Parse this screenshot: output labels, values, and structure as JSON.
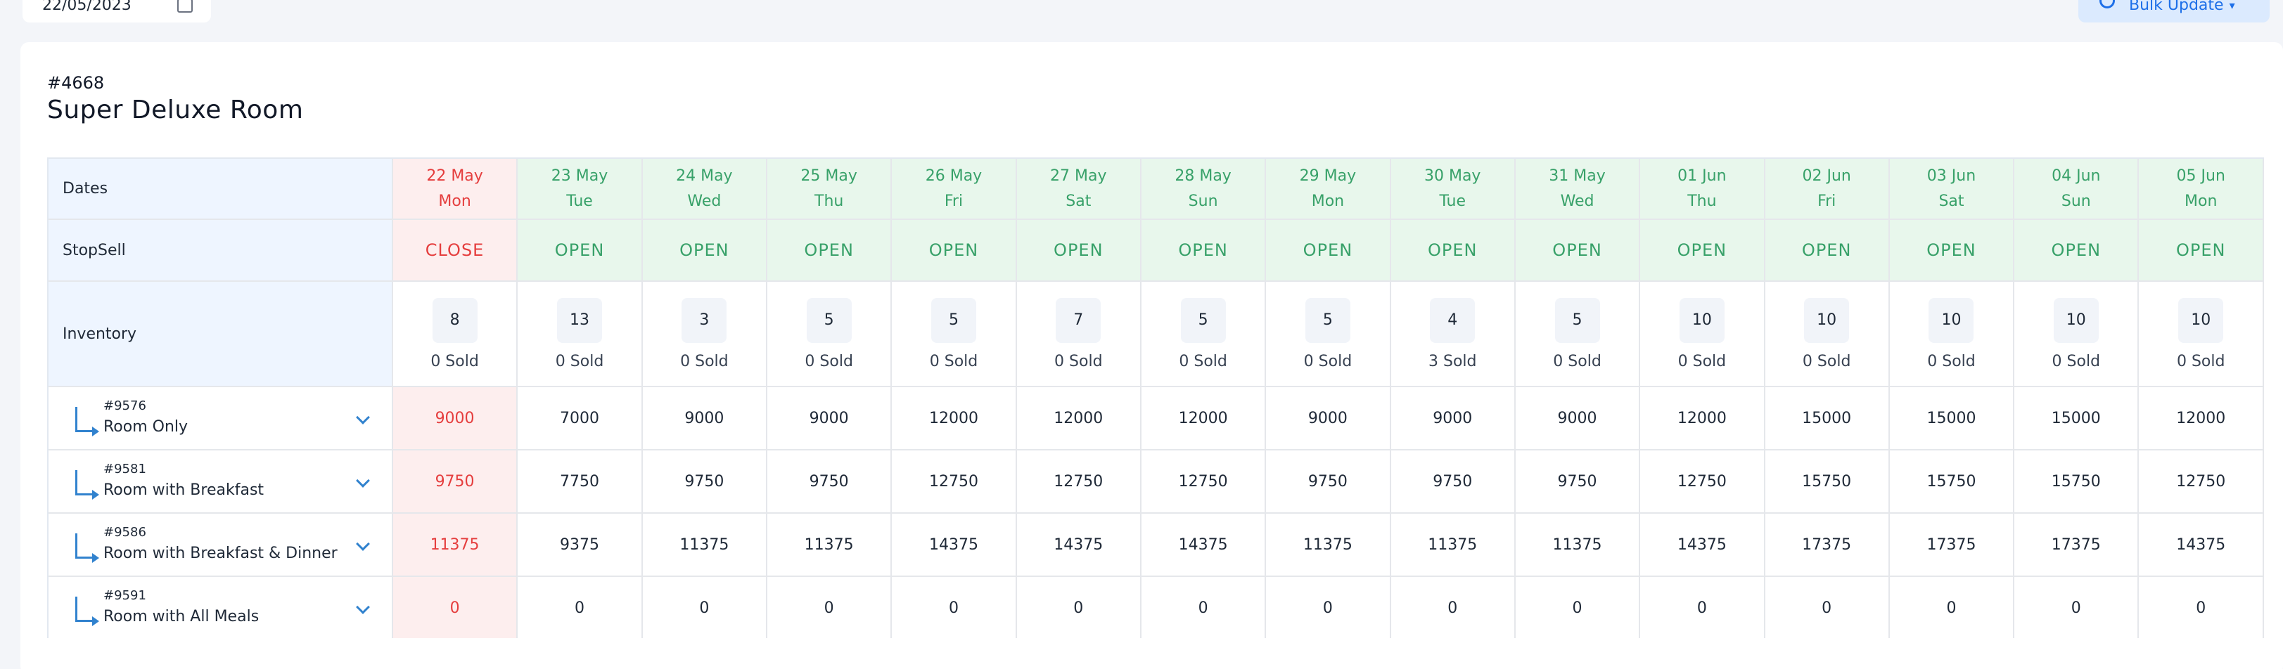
{
  "toolbar": {
    "date_value": "22/05/2023",
    "bulk_update_label": "Bulk Update"
  },
  "room": {
    "id": "#4668",
    "title": "Super Deluxe Room"
  },
  "row_labels": {
    "dates": "Dates",
    "stopsell": "StopSell",
    "inventory": "Inventory"
  },
  "days": [
    {
      "date": "22 May",
      "weekday": "Mon",
      "stopsell": "CLOSE",
      "inventory": "8",
      "sold": "0 Sold"
    },
    {
      "date": "23 May",
      "weekday": "Tue",
      "stopsell": "OPEN",
      "inventory": "13",
      "sold": "0 Sold"
    },
    {
      "date": "24 May",
      "weekday": "Wed",
      "stopsell": "OPEN",
      "inventory": "3",
      "sold": "0 Sold"
    },
    {
      "date": "25 May",
      "weekday": "Thu",
      "stopsell": "OPEN",
      "inventory": "5",
      "sold": "0 Sold"
    },
    {
      "date": "26 May",
      "weekday": "Fri",
      "stopsell": "OPEN",
      "inventory": "5",
      "sold": "0 Sold"
    },
    {
      "date": "27 May",
      "weekday": "Sat",
      "stopsell": "OPEN",
      "inventory": "7",
      "sold": "0 Sold"
    },
    {
      "date": "28 May",
      "weekday": "Sun",
      "stopsell": "OPEN",
      "inventory": "5",
      "sold": "0 Sold"
    },
    {
      "date": "29 May",
      "weekday": "Mon",
      "stopsell": "OPEN",
      "inventory": "5",
      "sold": "0 Sold"
    },
    {
      "date": "30 May",
      "weekday": "Tue",
      "stopsell": "OPEN",
      "inventory": "4",
      "sold": "3 Sold"
    },
    {
      "date": "31 May",
      "weekday": "Wed",
      "stopsell": "OPEN",
      "inventory": "5",
      "sold": "0 Sold"
    },
    {
      "date": "01 Jun",
      "weekday": "Thu",
      "stopsell": "OPEN",
      "inventory": "10",
      "sold": "0 Sold"
    },
    {
      "date": "02 Jun",
      "weekday": "Fri",
      "stopsell": "OPEN",
      "inventory": "10",
      "sold": "0 Sold"
    },
    {
      "date": "03 Jun",
      "weekday": "Sat",
      "stopsell": "OPEN",
      "inventory": "10",
      "sold": "0 Sold"
    },
    {
      "date": "04 Jun",
      "weekday": "Sun",
      "stopsell": "OPEN",
      "inventory": "10",
      "sold": "0 Sold"
    },
    {
      "date": "05 Jun",
      "weekday": "Mon",
      "stopsell": "OPEN",
      "inventory": "10",
      "sold": "0 Sold"
    }
  ],
  "rate_plans": [
    {
      "id": "#9576",
      "name": "Room Only",
      "rates": [
        "9000",
        "7000",
        "9000",
        "9000",
        "12000",
        "12000",
        "12000",
        "9000",
        "9000",
        "9000",
        "12000",
        "15000",
        "15000",
        "15000",
        "12000"
      ]
    },
    {
      "id": "#9581",
      "name": "Room with Breakfast",
      "rates": [
        "9750",
        "7750",
        "9750",
        "9750",
        "12750",
        "12750",
        "12750",
        "9750",
        "9750",
        "9750",
        "12750",
        "15750",
        "15750",
        "15750",
        "12750"
      ]
    },
    {
      "id": "#9586",
      "name": "Room with Breakfast & Dinner",
      "rates": [
        "11375",
        "9375",
        "11375",
        "11375",
        "14375",
        "14375",
        "14375",
        "11375",
        "11375",
        "11375",
        "14375",
        "17375",
        "17375",
        "17375",
        "14375"
      ]
    },
    {
      "id": "#9591",
      "name": "Room with All Meals",
      "rates": [
        "0",
        "0",
        "0",
        "0",
        "0",
        "0",
        "0",
        "0",
        "0",
        "0",
        "0",
        "0",
        "0",
        "0",
        "0"
      ]
    }
  ],
  "colors": {
    "open": "#38a169",
    "close": "#e53e3e",
    "accent": "#1d6fe8"
  },
  "icons": {
    "date_picker": "calendar-icon",
    "bulk_update": "gear-icon",
    "plan_link": "arrow-down-right-icon",
    "plan_expand": "chevron-down-icon"
  }
}
